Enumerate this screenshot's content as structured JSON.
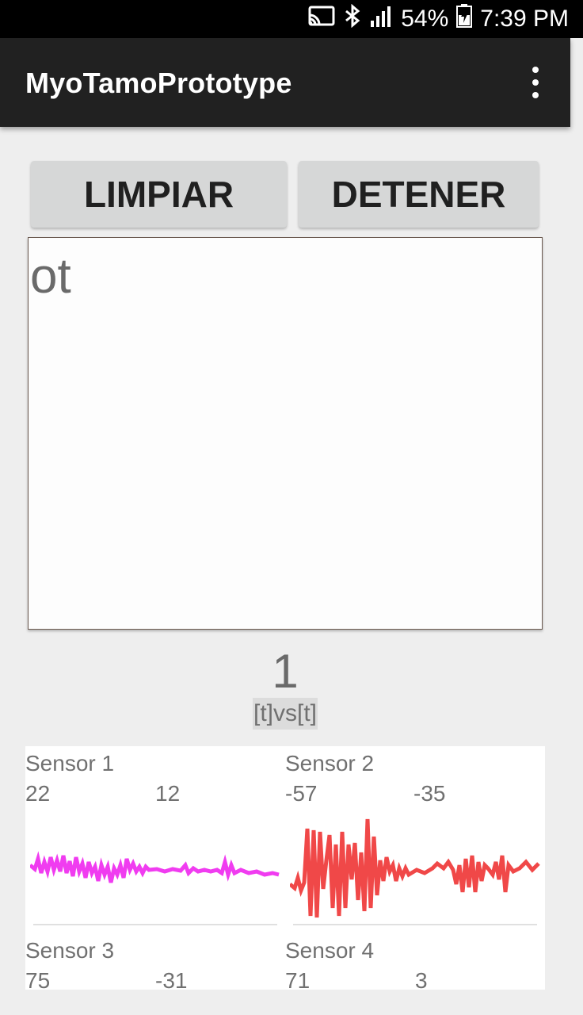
{
  "status": {
    "battery": "54%",
    "time": "7:39 PM"
  },
  "appbar": {
    "title": "MyoTamoPrototype"
  },
  "buttons": {
    "limpiar": "LIMPIAR",
    "detener": "DETENER"
  },
  "panel": {
    "text": "ot"
  },
  "counter": "1",
  "vs_label": "[t]vs[t]",
  "sensors": [
    {
      "name": "Sensor 1",
      "value_a": "22",
      "value_b": "12",
      "color": "#f03cf0"
    },
    {
      "name": "Sensor 2",
      "value_a": "-57",
      "value_b": "-35",
      "color": "#f04848"
    },
    {
      "name": "Sensor 3",
      "value_a": "75",
      "value_b": "-31"
    },
    {
      "name": "Sensor 4",
      "value_a": "71",
      "value_b": "3"
    }
  ]
}
